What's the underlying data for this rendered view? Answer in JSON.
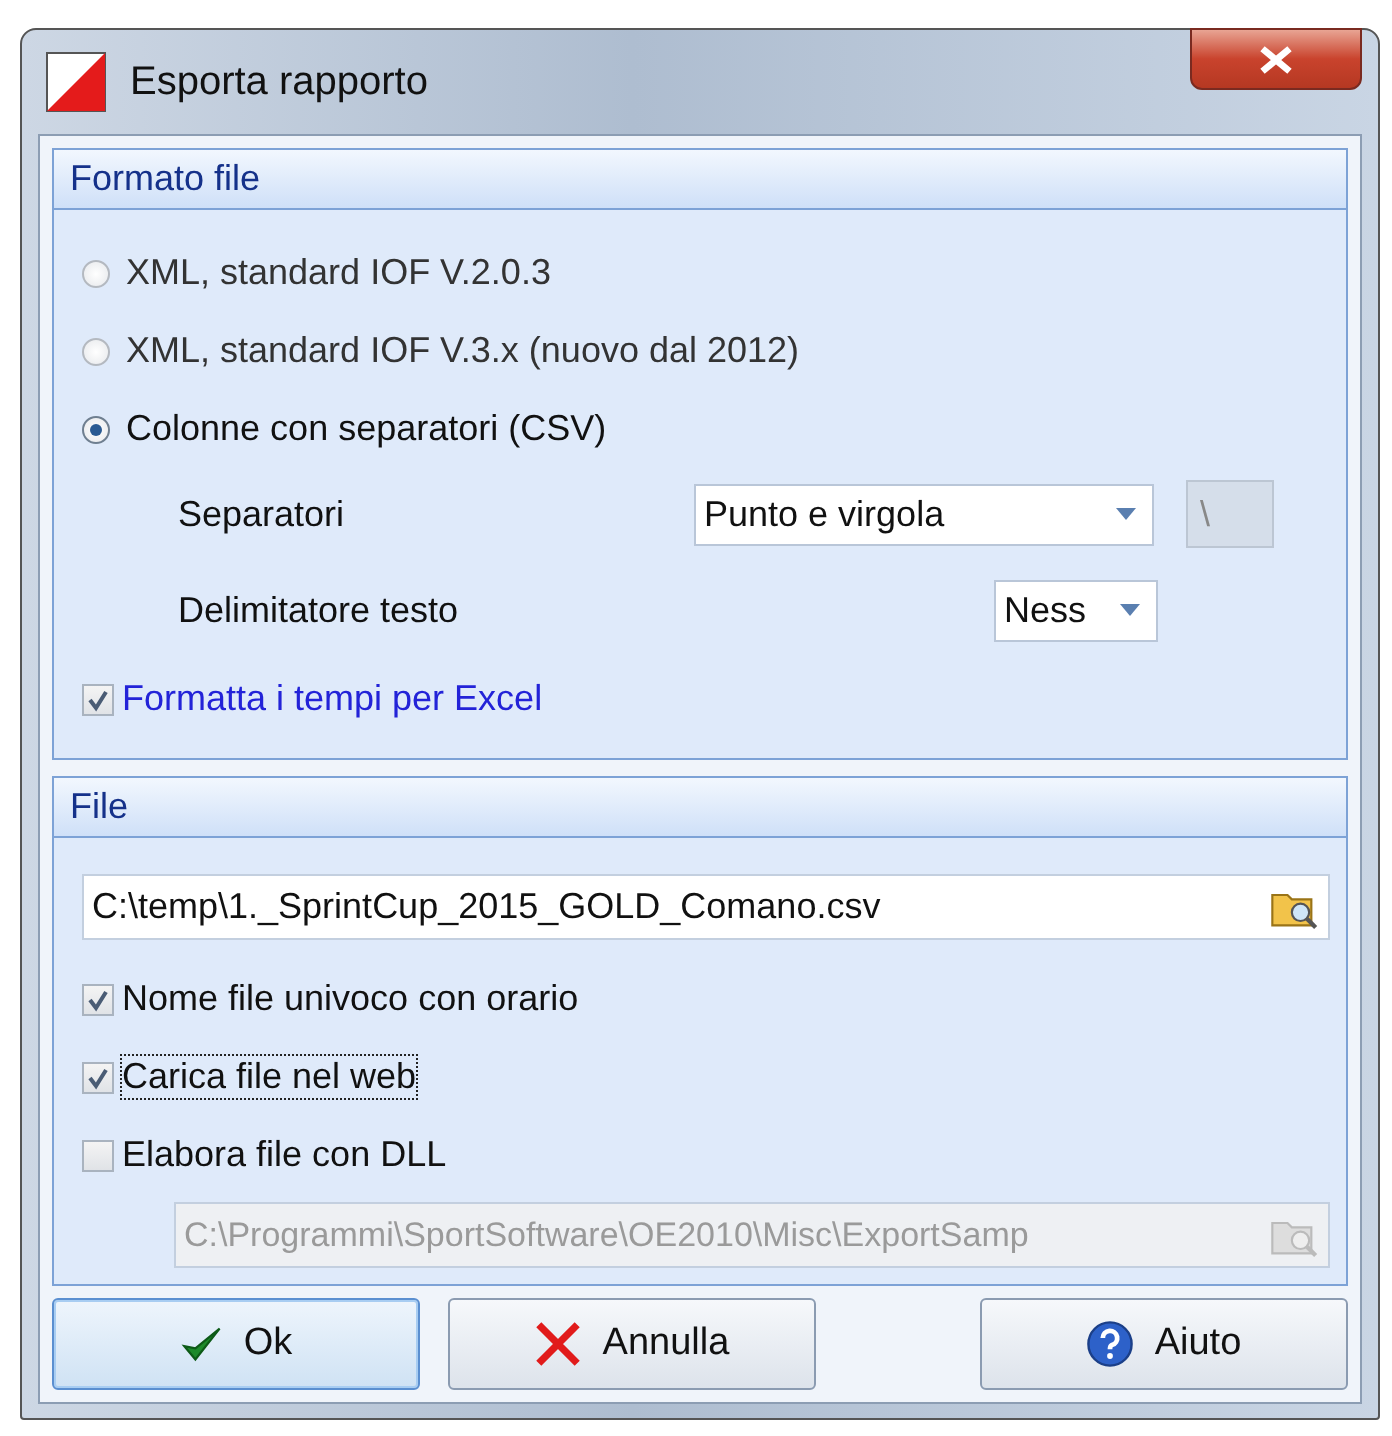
{
  "window": {
    "title": "Esporta rapporto"
  },
  "format_section": {
    "title": "Formato file",
    "options": [
      {
        "label": "XML, standard IOF V.2.0.3",
        "selected": false
      },
      {
        "label": "XML, standard IOF V.3.x (nuovo dal 2012)",
        "selected": false
      },
      {
        "label": "Colonne con separatori (CSV)",
        "selected": true
      }
    ],
    "separators": {
      "label": "Separatori",
      "value": "Punto e virgola",
      "custom": "\\"
    },
    "text_delimiter": {
      "label": "Delimitatore testo",
      "value": "Ness"
    },
    "excel_times": {
      "label": "Formatta i tempi per Excel",
      "checked": true
    }
  },
  "file_section": {
    "title": "File",
    "path": "C:\\temp\\1._SprintCup_2015_GOLD_Comano.csv",
    "options": [
      {
        "label": "Nome file univoco con orario",
        "checked": true,
        "focused": false
      },
      {
        "label": "Carica file nel web",
        "checked": true,
        "focused": true
      },
      {
        "label": "Elabora file con DLL",
        "checked": false,
        "focused": false
      }
    ],
    "dll_path": {
      "value": "C:\\Programmi\\SportSoftware\\OE2010\\Misc\\ExportSamp",
      "disabled": true
    }
  },
  "buttons": [
    {
      "label": "Ok",
      "kind": "ok",
      "default": true
    },
    {
      "label": "Annulla",
      "kind": "cancel",
      "default": false
    },
    {
      "label": "Aiuto",
      "kind": "help",
      "default": false
    }
  ]
}
